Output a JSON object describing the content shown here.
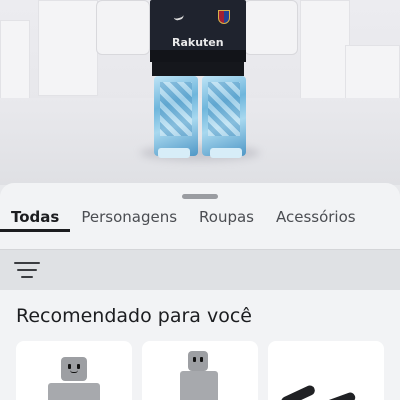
{
  "avatar": {
    "shirt_sponsor": "Rakuten",
    "shirt_color": "#1f232e",
    "pants_color": "#6fb6dc"
  },
  "tabs": [
    {
      "label": "Todas",
      "active": true
    },
    {
      "label": "Personagens",
      "active": false
    },
    {
      "label": "Roupas",
      "active": false
    },
    {
      "label": "Acessórios",
      "active": false
    }
  ],
  "filter": {
    "icon": "filter-icon"
  },
  "section": {
    "title": "Recomendado para você"
  },
  "colors": {
    "sheet_bg": "#f2f3f5",
    "filter_bar_bg": "#dfe1e4",
    "active_tab": "#1c1d20",
    "card_bg": "#ffffff"
  }
}
